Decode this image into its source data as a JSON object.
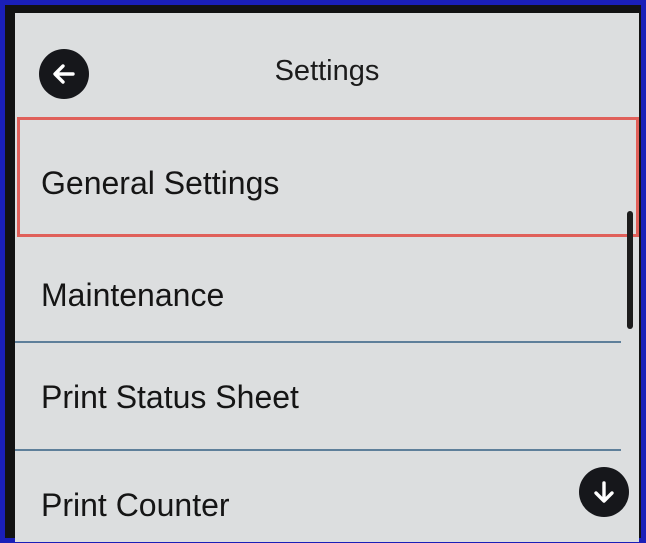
{
  "header": {
    "title": "Settings",
    "back_icon": "back-arrow-icon"
  },
  "menu": {
    "items": [
      {
        "label": "General Settings",
        "highlighted": true
      },
      {
        "label": "Maintenance"
      },
      {
        "label": "Print Status Sheet"
      },
      {
        "label": "Print Counter"
      }
    ]
  },
  "scroll": {
    "down_icon": "down-arrow-icon"
  },
  "colors": {
    "screen_background": "#dcdedf",
    "button_background": "#16171b",
    "highlight_border": "#e0605a",
    "divider": "#5e7f9a",
    "frame_border": "#1a1fb8"
  }
}
